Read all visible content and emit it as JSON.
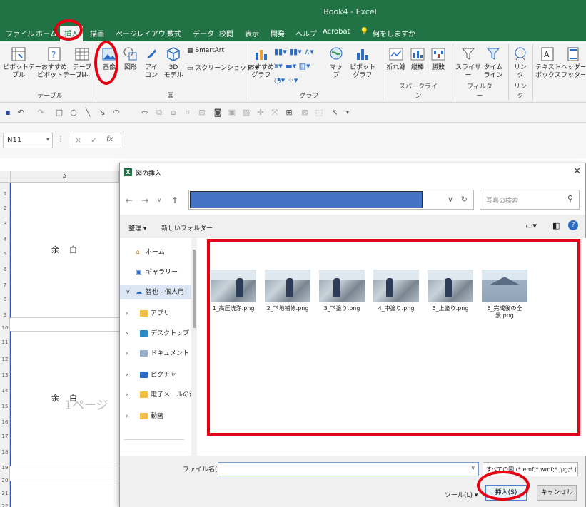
{
  "app": {
    "window_title": "Book4 - Excel"
  },
  "ribbon_tabs": [
    "ファイル",
    "ホーム",
    "挿入",
    "描画",
    "ページレイアウト",
    "数式",
    "データ",
    "校閲",
    "表示",
    "開発",
    "ヘルプ",
    "Acrobat",
    "何をしますか"
  ],
  "active_tab": "挿入",
  "ribbon": {
    "pivot_table": "ピボットテー\nブル",
    "recommended_pivot": "おすすめ\nピボットテーブル",
    "table": "テーブル",
    "group_table": "テーブル",
    "image": "画像",
    "shapes": "図形",
    "icons": "アイ\nコン",
    "models_3d": "3D\nモデル",
    "smartart": "SmartArt",
    "screenshot": "スクリーンショット",
    "group_figure": "図",
    "recommended_charts": "おすすめ\nグラフ",
    "map": "マップ",
    "pivot_chart": "ピボットグラフ",
    "group_chart": "グラフ",
    "sparkline_line": "折れ線",
    "sparkline_column": "縦棒",
    "sparkline_winloss": "勝敗",
    "group_sparkline": "スパークライン",
    "slicer": "スライサー",
    "timeline": "タイム\nライン",
    "group_filter": "フィルター",
    "link": "リン\nク",
    "group_link": "リンク",
    "textbox": "テキスト\nボックス",
    "header_footer": "ヘッダーと\nフッター"
  },
  "formula_bar": {
    "name_box": "N11",
    "cancel": "×",
    "enter": "✓",
    "fx": "fx"
  },
  "sheet": {
    "column_a": "A",
    "rows": [
      "1",
      "2",
      "3",
      "4",
      "5",
      "6",
      "7",
      "8",
      "9",
      "10",
      "11",
      "12",
      "13",
      "14",
      "15",
      "16",
      "17",
      "18",
      "19",
      "20",
      "21",
      "22"
    ],
    "cell_text_1": "余白",
    "cell_text_2": "余白",
    "page_watermark": "1ページ"
  },
  "dialog": {
    "title": "図の挿入",
    "search_placeholder": "写真の検索",
    "organize": "整理 ▾",
    "new_folder": "新しいフォルダー",
    "nav_items": [
      {
        "label": "ホーム",
        "type": "home"
      },
      {
        "label": "ギャラリー",
        "type": "gallery"
      },
      {
        "label": "智也 - 個人用",
        "type": "cloud",
        "selected": true
      },
      {
        "label": "アプリ",
        "type": "folder"
      },
      {
        "label": "デスクトップ",
        "type": "folder"
      },
      {
        "label": "ドキュメント",
        "type": "folder"
      },
      {
        "label": "ピクチャ",
        "type": "folder"
      },
      {
        "label": "電子メールの添付",
        "type": "folder"
      },
      {
        "label": "動画",
        "type": "folder"
      }
    ],
    "files": [
      {
        "name": "1_高圧洗浄.png"
      },
      {
        "name": "2_下地補修.png"
      },
      {
        "name": "3_下塗り.png"
      },
      {
        "name": "4_中塗り.png"
      },
      {
        "name": "5_上塗り.png"
      },
      {
        "name": "6_完成後の全景.png"
      }
    ],
    "filename_label": "ファイル名(N):",
    "filename_value": "",
    "filetype": "すべての図 (*.emf;*.wmf;*.jpg;*.j",
    "tools": "ツール(L)",
    "insert_button": "挿入(S)",
    "cancel_button": "キャンセル"
  },
  "annotation_color": "#e60012"
}
